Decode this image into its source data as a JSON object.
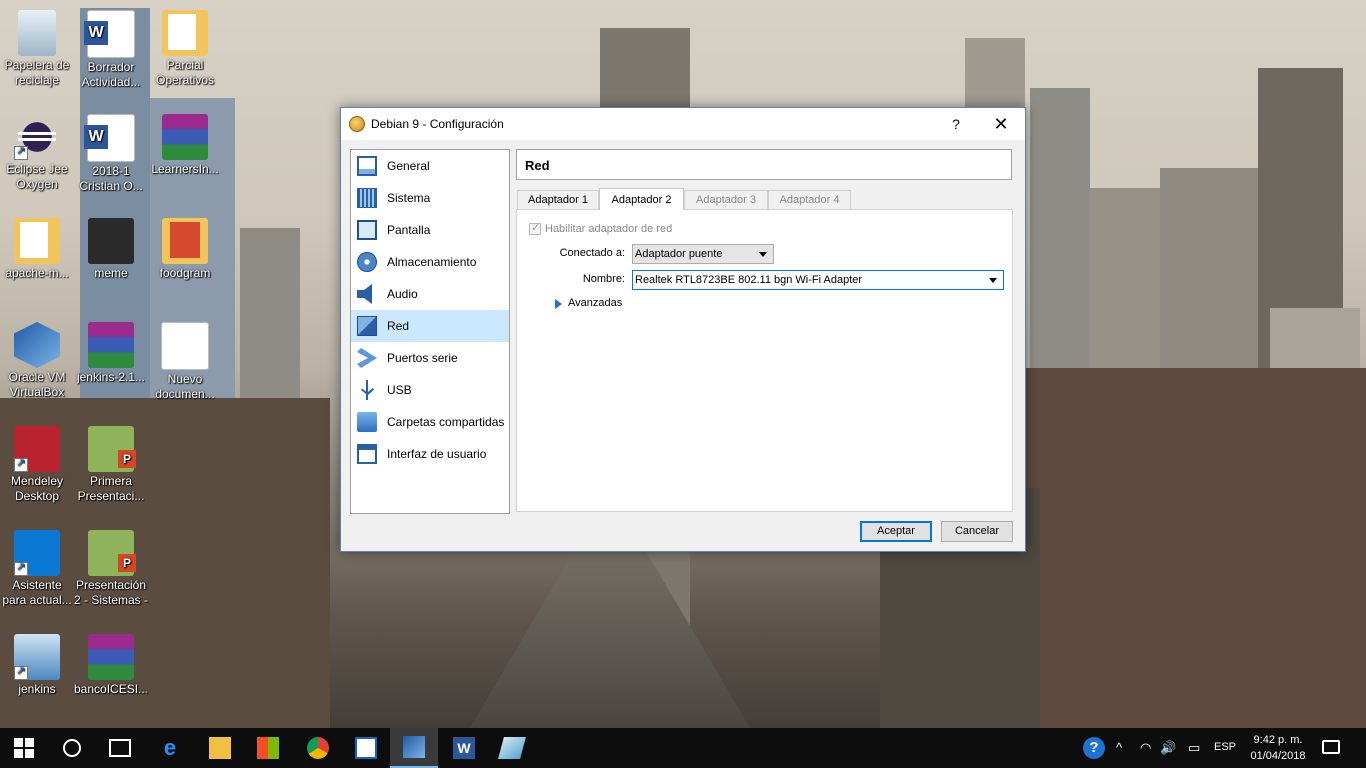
{
  "desktop": {
    "icons": [
      {
        "label": "Papelera de reciclaje",
        "icon": "recycle-bin-icon"
      },
      {
        "label": "Borrador Actividad...",
        "icon": "word-doc-icon"
      },
      {
        "label": "Parcial Operativos",
        "icon": "folder-icon"
      },
      {
        "label": "Eclipse Jee Oxygen",
        "icon": "eclipse-icon"
      },
      {
        "label": "2018-1 Cristian O...",
        "icon": "word-doc-icon"
      },
      {
        "label": "LearnersIn...",
        "icon": "winrar-icon"
      },
      {
        "label": "apache-m...",
        "icon": "folder-icon"
      },
      {
        "label": "meme",
        "icon": "image-icon"
      },
      {
        "label": "foodgram",
        "icon": "folder-icon"
      },
      {
        "label": "Oracle VM VirtualBox",
        "icon": "virtualbox-icon"
      },
      {
        "label": "jenkins-2.1...",
        "icon": "winrar-icon"
      },
      {
        "label": "Nuevo documen...",
        "icon": "text-doc-icon"
      },
      {
        "label": "Mendeley Desktop",
        "icon": "mendeley-icon"
      },
      {
        "label": "Primera Presentaci...",
        "icon": "powerpoint-icon"
      },
      {
        "label": "Asistente para actual...",
        "icon": "windows-icon"
      },
      {
        "label": "Presentación 2 - Sistemas -",
        "icon": "powerpoint-icon"
      },
      {
        "label": "jenkins",
        "icon": "jenkins-icon"
      },
      {
        "label": "bancoICESI...",
        "icon": "winrar-icon"
      }
    ]
  },
  "dialog": {
    "title": "Debian 9 - Configuración",
    "help_label": "?",
    "close_label": "✕",
    "nav_items": [
      {
        "label": "General",
        "icon": "general-icon"
      },
      {
        "label": "Sistema",
        "icon": "chip-icon"
      },
      {
        "label": "Pantalla",
        "icon": "monitor-icon"
      },
      {
        "label": "Almacenamiento",
        "icon": "disk-icon"
      },
      {
        "label": "Audio",
        "icon": "speaker-icon"
      },
      {
        "label": "Red",
        "icon": "network-icon",
        "selected": true
      },
      {
        "label": "Puertos serie",
        "icon": "serial-port-icon"
      },
      {
        "label": "USB",
        "icon": "usb-icon"
      },
      {
        "label": "Carpetas compartidas",
        "icon": "shared-folder-icon"
      },
      {
        "label": "Interfaz de usuario",
        "icon": "user-interface-icon"
      }
    ],
    "section_title": "Red",
    "tabs": [
      {
        "label": "Adaptador 1",
        "state": "normal"
      },
      {
        "label": "Adaptador 2",
        "state": "active"
      },
      {
        "label": "Adaptador 3",
        "state": "disabled"
      },
      {
        "label": "Adaptador 4",
        "state": "disabled"
      }
    ],
    "enable_adapter": {
      "label": "Habilitar adaptador de red",
      "checked": true
    },
    "connected_to": {
      "label": "Conectado a:",
      "value": "Adaptador puente"
    },
    "name": {
      "label": "Nombre:",
      "value": "Realtek RTL8723BE 802.11 bgn Wi-Fi Adapter"
    },
    "advanced_label": "Avanzadas",
    "ok_label": "Aceptar",
    "cancel_label": "Cancelar"
  },
  "taskbar": {
    "apps": [
      "start-icon",
      "search-icon",
      "task-view-icon",
      "edge-icon",
      "file-explorer-icon",
      "store-icon",
      "chrome-icon",
      "photos-icon",
      "virtualbox-icon",
      "word-icon",
      "glass-app-icon"
    ],
    "tray": {
      "help": "?",
      "chevron": "^",
      "wifi": "◠",
      "volume": "🔊",
      "battery": "▭",
      "language": "ESP",
      "time": "9:42 p. m.",
      "date": "01/04/2018"
    }
  }
}
